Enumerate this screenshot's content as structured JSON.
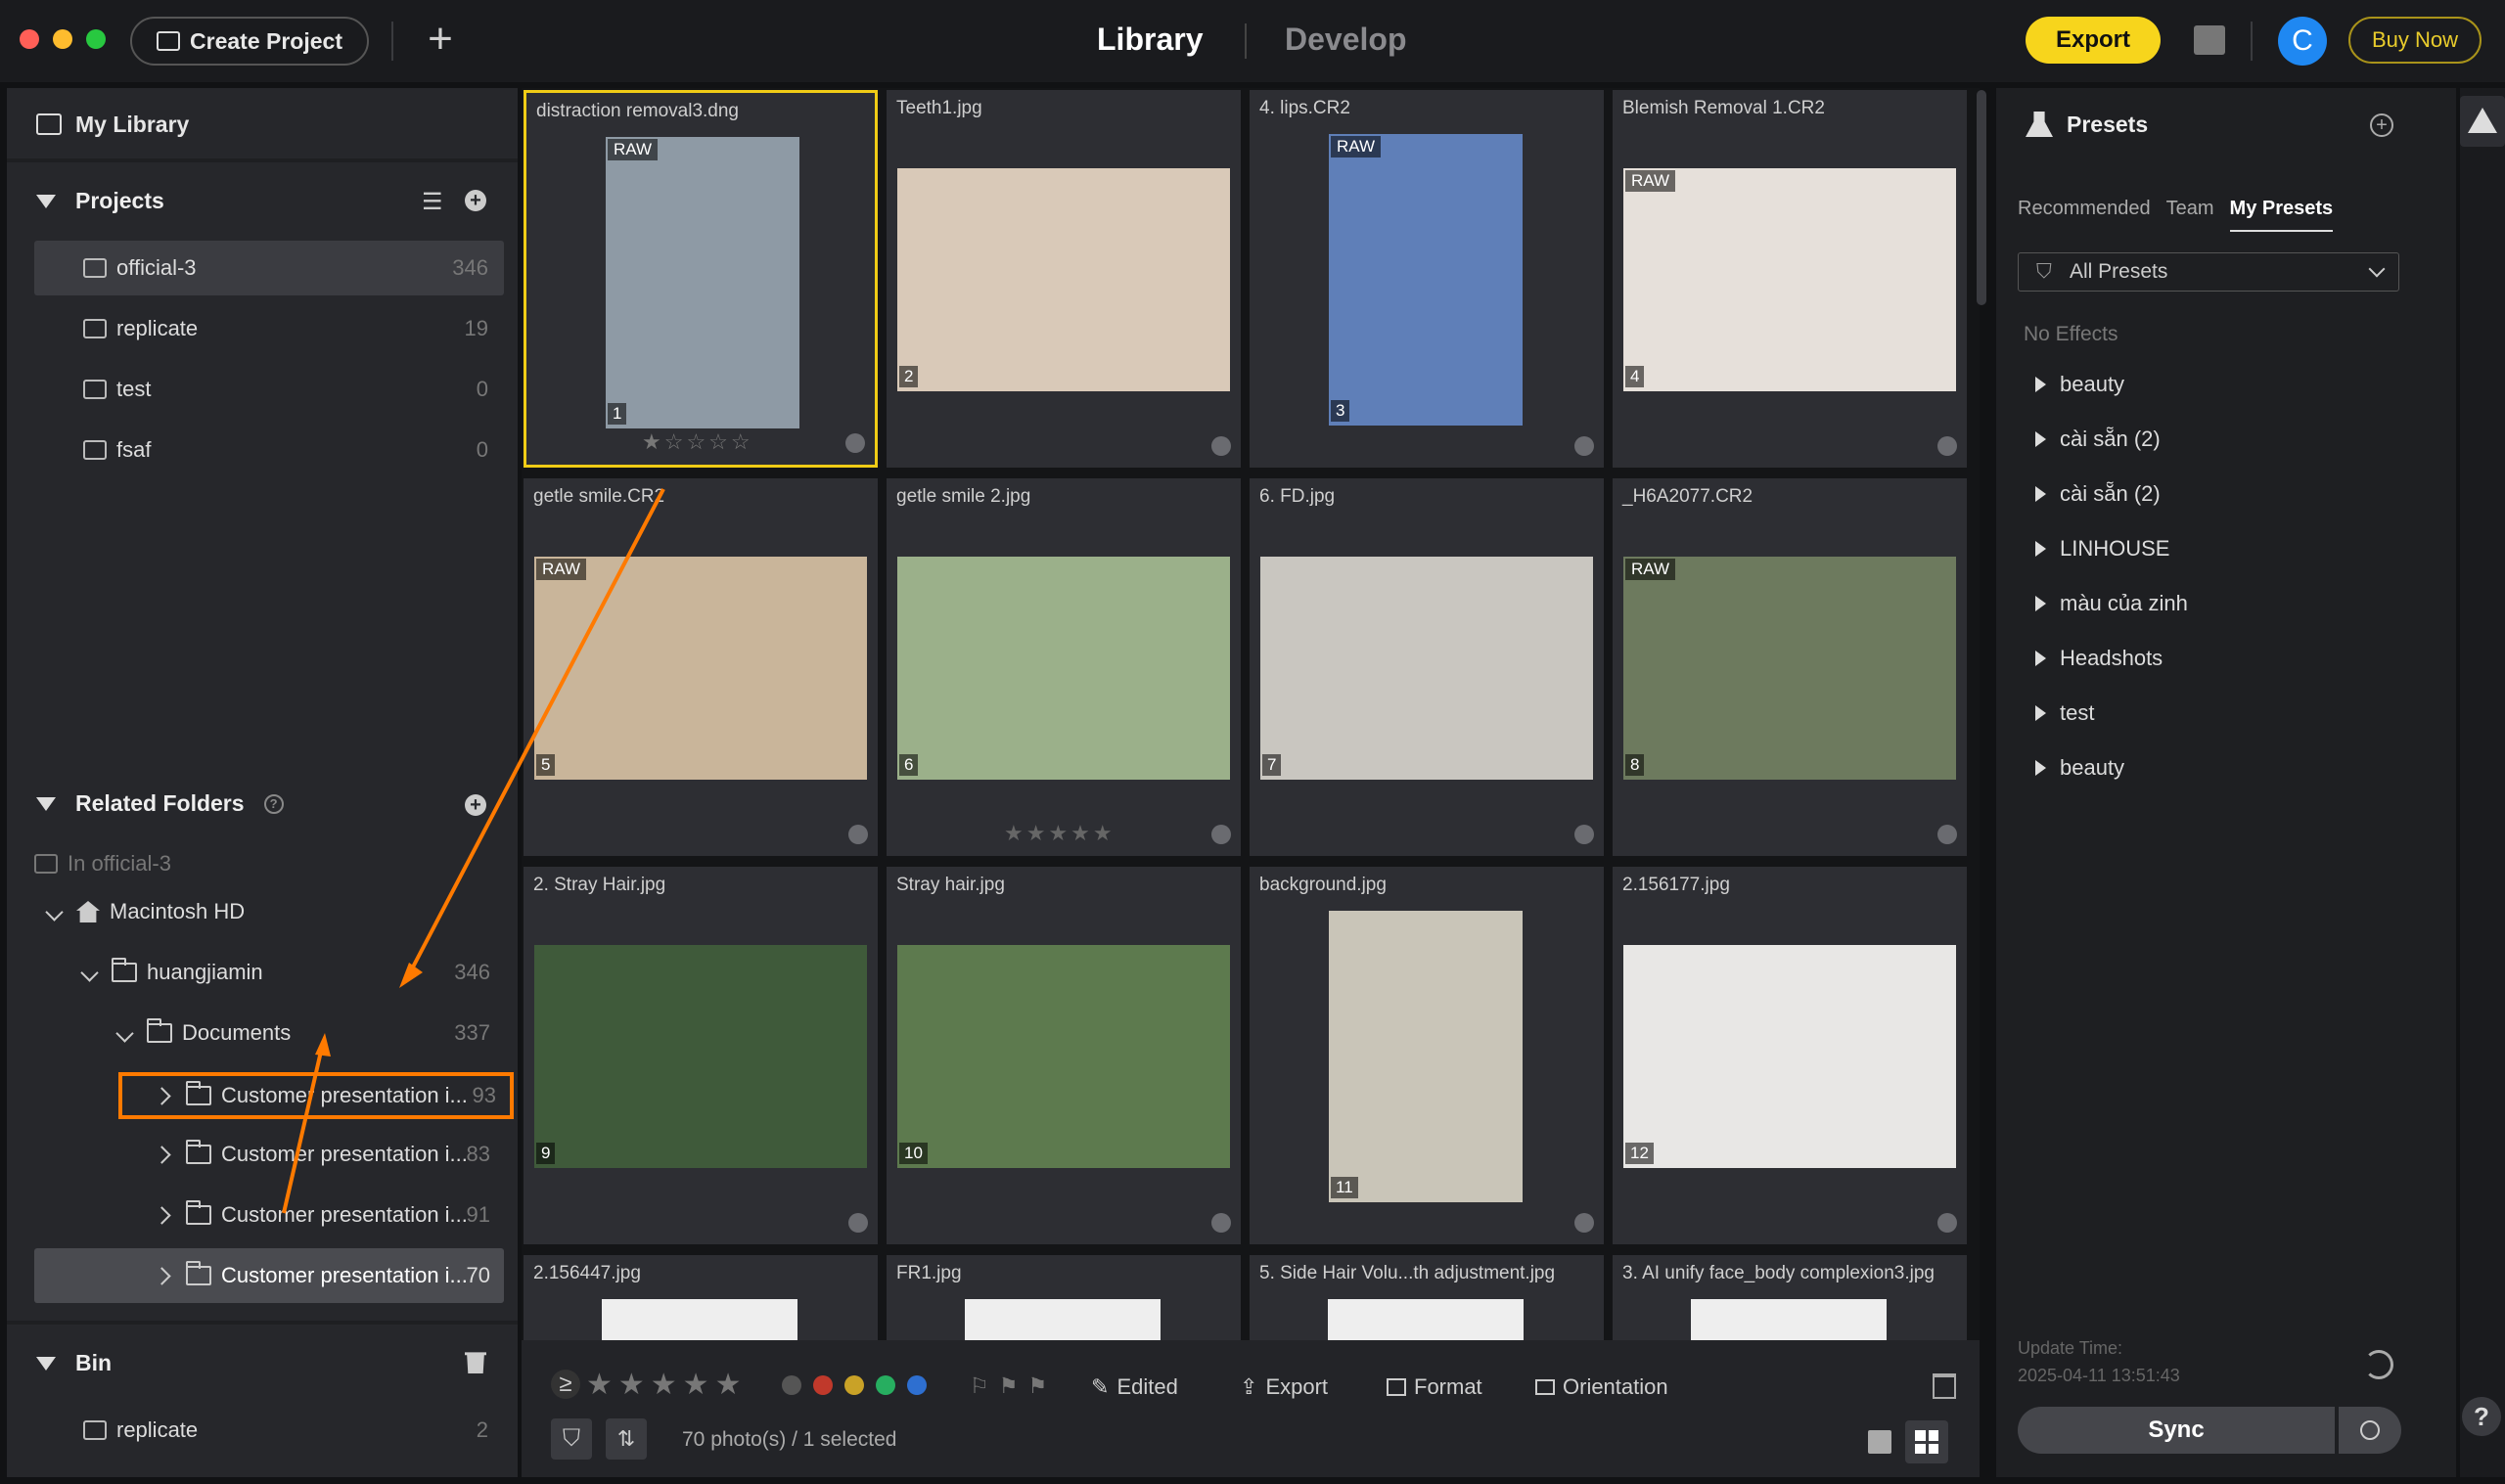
{
  "window": {
    "traffic_lights": [
      "#ff5f57",
      "#febc2e",
      "#28c840"
    ]
  },
  "header": {
    "create_project_label": "Create Project",
    "modes": [
      {
        "label": "Library",
        "active": true
      },
      {
        "label": "Develop",
        "active": false
      }
    ],
    "export_label": "Export",
    "avatar_letter": "C",
    "buy_now_label": "Buy Now",
    "accent_color": "#f7d51c"
  },
  "sidebar": {
    "library_title": "My Library",
    "projects_title": "Projects",
    "projects": [
      {
        "name": "official-3",
        "count": "346",
        "selected": true
      },
      {
        "name": "replicate",
        "count": "19"
      },
      {
        "name": "test",
        "count": "0"
      },
      {
        "name": "fsaf",
        "count": "0"
      }
    ],
    "related_folders_title": "Related Folders",
    "in_project_label": "In official-3",
    "tree": {
      "volume": "Macintosh HD",
      "user": {
        "name": "huangjiamin",
        "count": "346"
      },
      "documents": {
        "name": "Documents",
        "count": "337"
      },
      "folders": [
        {
          "name": "Customer presentation i...",
          "count": "93",
          "highlighted": true
        },
        {
          "name": "Customer presentation i...",
          "count": "83"
        },
        {
          "name": "Customer presentation i...",
          "count": "91"
        },
        {
          "name": "Customer presentation i...",
          "count": "70",
          "selected": true
        }
      ]
    },
    "bin_title": "Bin",
    "bin_items": [
      {
        "name": "replicate",
        "count": "2"
      }
    ]
  },
  "grid": {
    "photos": [
      {
        "name": "distraction removal3.dng",
        "index": "1",
        "badge": "RAW",
        "stars": "★☆☆☆☆"
      },
      {
        "name": "Teeth1.jpg",
        "index": "2"
      },
      {
        "name": "4. lips.CR2",
        "index": "3",
        "badge": "RAW"
      },
      {
        "name": "Blemish Removal 1.CR2",
        "index": "4",
        "badge": "RAW"
      },
      {
        "name": "getle smile.CR2",
        "index": "5",
        "badge": "RAW"
      },
      {
        "name": "getle smile 2.jpg",
        "index": "6",
        "stars": "★★★★★"
      },
      {
        "name": "6. FD.jpg",
        "index": "7"
      },
      {
        "name": "_H6A2077.CR2",
        "index": "8",
        "badge": "RAW"
      },
      {
        "name": "2. Stray Hair.jpg",
        "index": "9"
      },
      {
        "name": "Stray hair.jpg",
        "index": "10"
      },
      {
        "name": "background.jpg",
        "index": "11"
      },
      {
        "name": "2.156177.jpg",
        "index": "12"
      },
      {
        "name": "2.156447.jpg",
        "index": ""
      },
      {
        "name": "FR1.jpg",
        "index": ""
      },
      {
        "name": "5. Side Hair Volu...th adjustment.jpg",
        "index": ""
      },
      {
        "name": "3. AI unify face_body complexion3.jpg",
        "index": ""
      }
    ]
  },
  "toolbar": {
    "rating_operator": "≥",
    "color_labels": [
      "#555555",
      "#c0392b",
      "#c9a227",
      "#27ae60",
      "#2e6fd0"
    ],
    "edited_label": "Edited",
    "export_label": "Export",
    "format_label": "Format",
    "orientation_label": "Orientation",
    "status": "70 photo(s) / 1 selected"
  },
  "presets": {
    "title": "Presets",
    "tabs": [
      "Recommended",
      "Team",
      "My Presets"
    ],
    "active_tab": "My Presets",
    "filter_value": "All Presets",
    "no_effects_label": "No Effects",
    "groups": [
      "beauty",
      "cài sẵn (2)",
      "cài sẵn (2)",
      "LINHOUSE",
      "màu của zinh",
      "Headshots",
      "test",
      "beauty"
    ],
    "update_time_label": "Update Time:",
    "update_time_value": "2025-04-11 13:51:43",
    "sync_label": "Sync"
  },
  "annotation": {
    "color": "#ff7a00"
  }
}
